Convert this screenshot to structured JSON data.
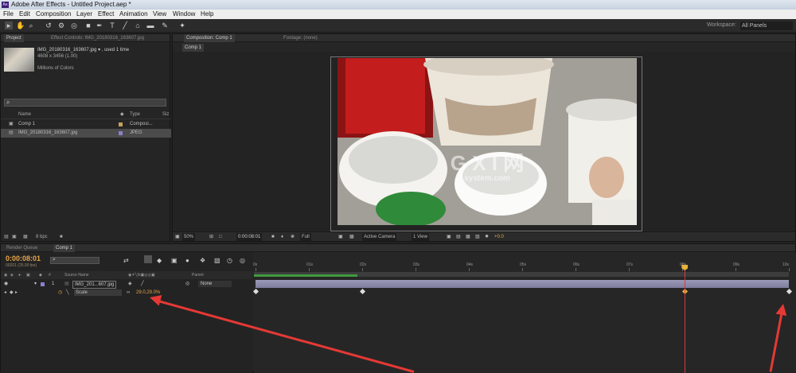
{
  "app": {
    "title": "Adobe After Effects - Untitled Project.aep *",
    "logo_text": "Ae"
  },
  "menu": [
    "File",
    "Edit",
    "Composition",
    "Layer",
    "Effect",
    "Animation",
    "View",
    "Window",
    "Help"
  ],
  "workspace": {
    "label": "Workspace:",
    "value": "All Panels"
  },
  "project_panel": {
    "tabs": [
      "Project",
      "Effect Controls: IMG_20180316_163607.jpg"
    ],
    "item_name": "IMG_20180316_163607.jpg ▾ , used 1 time",
    "dims": "4608 x 3456 (1.00)",
    "colors": "Millions of Colors",
    "columns": [
      "Name",
      "Type",
      "Siz"
    ],
    "items": [
      {
        "name": "Comp 1",
        "type": "Composi...",
        "color": "#c8a05a"
      },
      {
        "name": "IMG_20180316_163607.jpg",
        "type": "JPEG",
        "color": "#8a80c8"
      }
    ],
    "bpc": "8 bpc"
  },
  "comp_panel": {
    "tabs": [
      "Composition: Comp 1",
      "Footage: (none)"
    ],
    "subtab": "Comp 1",
    "zoom": "50%",
    "timecode": "0:00:08:01",
    "resolution": "Full",
    "camera": "Active Camera",
    "views": "1 View",
    "exposure": "+0.0",
    "watermark": "G X I 网",
    "watermark_sub": "system.com"
  },
  "timeline": {
    "tabs": [
      "Render Queue",
      "Comp 1"
    ],
    "timecode": "0:00:08:01",
    "fps": "00201 (25.00 fps)",
    "ruler": [
      "0s",
      "01s",
      "02s",
      "03s",
      "04s",
      "05s",
      "06s",
      "07s",
      "08s",
      "09s",
      "10s"
    ],
    "headers": {
      "source": "Source Name",
      "parent": "Parent"
    },
    "layer": {
      "index": "1",
      "name": "IMG_201...607.jpg",
      "parent": "None"
    },
    "property": {
      "name": "Scale",
      "value": "29.0,29.0%"
    },
    "keyframes_s": [
      0,
      2,
      8.05,
      10
    ],
    "cti_s": 8.05,
    "colors": {
      "cti": "#d93a3a",
      "keyframe_active": "#e8b23c",
      "layer_bar": "#8d8dac",
      "annotation": "#e53935"
    }
  }
}
